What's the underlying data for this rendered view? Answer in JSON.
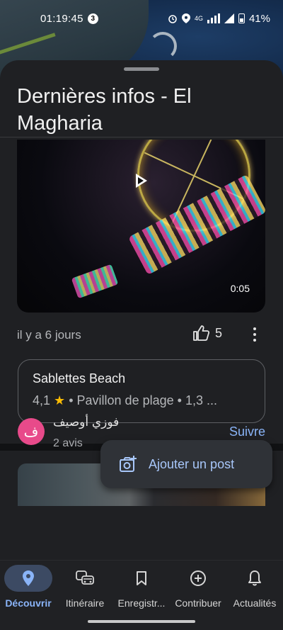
{
  "status_bar": {
    "time": "01:19:45",
    "notification_count": "3",
    "network": "4G",
    "battery": "41%"
  },
  "sheet": {
    "title": "Dernières infos - El Magharia"
  },
  "video": {
    "duration": "0:05"
  },
  "post": {
    "age": "il y a 6 jours",
    "likes": "5"
  },
  "place": {
    "name": "Sablettes Beach",
    "rating": "4,1",
    "category": "Pavillon de plage",
    "distance": "1,3 ..."
  },
  "author": {
    "initial": "ف",
    "name": "فوزي أوصيف",
    "reviews": "2 avis",
    "follow_label": "Suivre"
  },
  "fab": {
    "label": "Ajouter un post"
  },
  "nav": {
    "items": [
      {
        "label": "Découvrir",
        "icon": "pin-icon"
      },
      {
        "label": "Itinéraire",
        "icon": "commute-icon"
      },
      {
        "label": "Enregistr...",
        "icon": "bookmark-icon"
      },
      {
        "label": "Contribuer",
        "icon": "add-circle-icon"
      },
      {
        "label": "Actualités",
        "icon": "bell-icon"
      }
    ]
  },
  "colors": {
    "accent": "#8ab4f8",
    "active_nav_bg": "#3c4a63",
    "star": "#fbbc04",
    "avatar": "#e84a8a"
  }
}
